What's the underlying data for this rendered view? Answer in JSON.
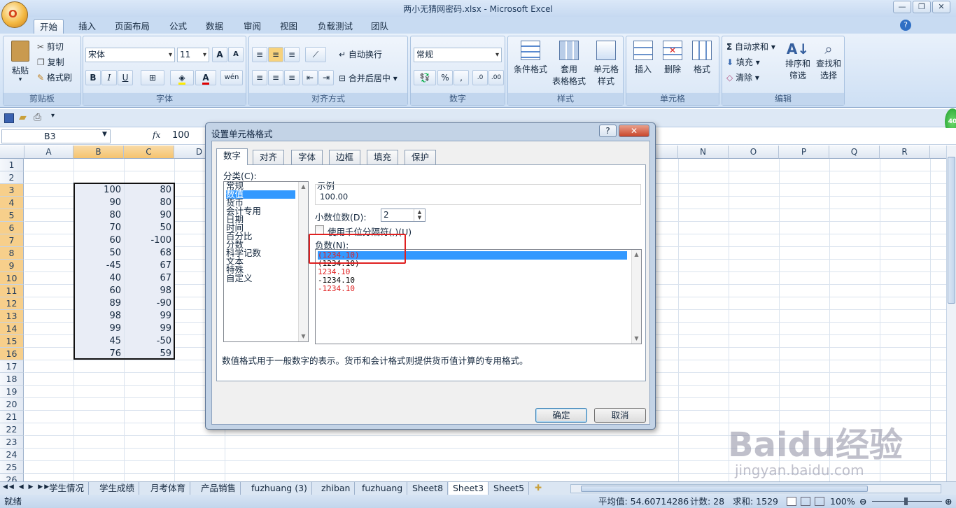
{
  "window": {
    "title": "两小无猜网密码.xlsx - Microsoft Excel",
    "office_button": "O",
    "min_label": "—",
    "max_label": "❐",
    "close_label": "✕"
  },
  "ribbon_tabs": [
    "开始",
    "插入",
    "页面布局",
    "公式",
    "数据",
    "审阅",
    "视图",
    "负载测试",
    "团队"
  ],
  "ribbon": {
    "clipboard": {
      "paste": "粘贴",
      "cut": "剪切",
      "copy": "复制",
      "format_painter": "格式刷",
      "label": "剪贴板"
    },
    "font": {
      "family": "宋体",
      "size": "11",
      "label": "字体",
      "bold": "B",
      "italic": "I",
      "underline": "U",
      "grow": "A",
      "shrink": "A",
      "phonetic": "wén"
    },
    "alignment": {
      "wrap": "自动换行",
      "merge": "合并后居中",
      "label": "对齐方式"
    },
    "number": {
      "format": "常规",
      "percent": "%",
      "comma": ",",
      "label": "数字"
    },
    "styles": {
      "conditional": "条件格式",
      "table1": "套用",
      "table2": "表格格式",
      "cell1": "单元格",
      "cell2": "样式",
      "label": "样式"
    },
    "cells": {
      "insert": "插入",
      "delete": "删除",
      "format": "格式",
      "label": "单元格"
    },
    "editing": {
      "autosum": "自动求和",
      "fill": "填充",
      "clear": "清除",
      "sort1": "排序和",
      "sort2": "筛选",
      "find1": "查找和",
      "find2": "选择",
      "label": "编辑"
    }
  },
  "formula_bar": {
    "cell_ref": "B3",
    "fx": "fx",
    "value": "100"
  },
  "columns": [
    "A",
    "B",
    "C",
    "D",
    "N",
    "O",
    "P",
    "Q",
    "R"
  ],
  "rows": [
    "1",
    "2",
    "3",
    "4",
    "5",
    "6",
    "7",
    "8",
    "9",
    "10",
    "11",
    "12",
    "13",
    "14",
    "15",
    "16",
    "17",
    "18",
    "19",
    "20",
    "21",
    "22",
    "23",
    "24",
    "25",
    "26"
  ],
  "col_b": [
    "100",
    "90",
    "80",
    "70",
    "60",
    "50",
    "-45",
    "40",
    "60",
    "89",
    "98",
    "99",
    "45",
    "76"
  ],
  "col_c": [
    "80",
    "80",
    "90",
    "50",
    "-100",
    "68",
    "67",
    "67",
    "98",
    "-90",
    "99",
    "99",
    "-50",
    "59"
  ],
  "sheet_tabs": [
    "学生情况",
    "学生成绩",
    "月考体育",
    "产品销售",
    "fuzhuang (3)",
    "zhiban",
    "fuzhuang",
    "Sheet8",
    "Sheet3",
    "Sheet5"
  ],
  "status": {
    "ready": "就绪",
    "average": "平均值: 54.60714286",
    "count": "计数: 28",
    "sum": "求和: 1529",
    "zoom": "100%"
  },
  "dialog": {
    "title": "设置单元格格式",
    "help": "?",
    "close": "✕",
    "tabs": [
      "数字",
      "对齐",
      "字体",
      "边框",
      "填充",
      "保护"
    ],
    "category_label": "分类(C):",
    "categories": [
      "常规",
      "数值",
      "货币",
      "会计专用",
      "日期",
      "时间",
      "百分比",
      "分数",
      "科学记数",
      "文本",
      "特殊",
      "自定义"
    ],
    "sample_label": "示例",
    "sample_value": "100.00",
    "decimal_label": "小数位数(D):",
    "decimal_value": "2",
    "thousands_label": "使用千位分隔符(,)(U)",
    "negative_label": "负数(N):",
    "negative_options": [
      "(1234.10)",
      "(1234.10)",
      "1234.10",
      "-1234.10",
      "-1234.10"
    ],
    "description": "数值格式用于一般数字的表示。货币和会计格式则提供货币值计算的专用格式。",
    "ok": "确定",
    "cancel": "取消"
  },
  "watermark": {
    "text": "Baidu经验",
    "url": "jingyan.baidu.com"
  },
  "badge": "40",
  "colors": {
    "accent": "#3399ff",
    "red": "#e02020",
    "selected_header": "#f5c36e"
  }
}
